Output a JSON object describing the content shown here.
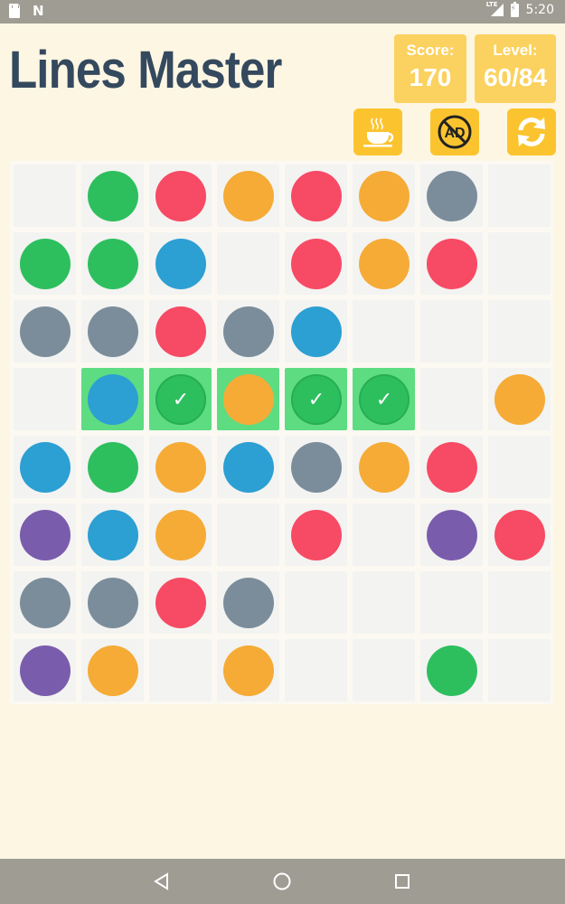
{
  "status_bar": {
    "time": "5:20",
    "network": "LTE"
  },
  "header": {
    "title": "Lines Master",
    "score_label": "Score:",
    "score_value": "170",
    "level_label": "Level:",
    "level_value": "60/84"
  },
  "buttons": {
    "coffee": "coffee-cup-icon",
    "no_ads": "no-ads-icon",
    "no_ads_text": "AD",
    "restart": "refresh-icon"
  },
  "colors": {
    "green": "#2dbf5e",
    "red": "#f74a64",
    "orange": "#f5ab36",
    "gray": "#7b8d9b",
    "blue": "#2c9fd3",
    "purple": "#7a5cad",
    "highlight": "#5ddc82",
    "accent": "#fbc42f"
  },
  "board": {
    "size": 8,
    "cells": [
      [
        "",
        "green",
        "red",
        "orange",
        "red",
        "orange",
        "gray",
        ""
      ],
      [
        "green",
        "green",
        "blue",
        "",
        "red",
        "orange",
        "red",
        ""
      ],
      [
        "gray",
        "gray",
        "red",
        "gray",
        "blue",
        "",
        "",
        ""
      ],
      [
        "",
        "blue*",
        "check",
        "orange*",
        "check",
        "check",
        "",
        "orange"
      ],
      [
        "blue",
        "green",
        "orange",
        "blue",
        "gray",
        "orange",
        "red",
        ""
      ],
      [
        "purple",
        "blue",
        "orange",
        "",
        "red",
        "",
        "purple",
        "red"
      ],
      [
        "gray",
        "gray",
        "red",
        "gray",
        "",
        "",
        "",
        ""
      ],
      [
        "purple",
        "orange",
        "",
        "orange",
        "",
        "",
        "green",
        ""
      ]
    ]
  },
  "nav": {
    "back": "back-icon",
    "home": "home-icon",
    "recent": "recent-apps-icon"
  }
}
